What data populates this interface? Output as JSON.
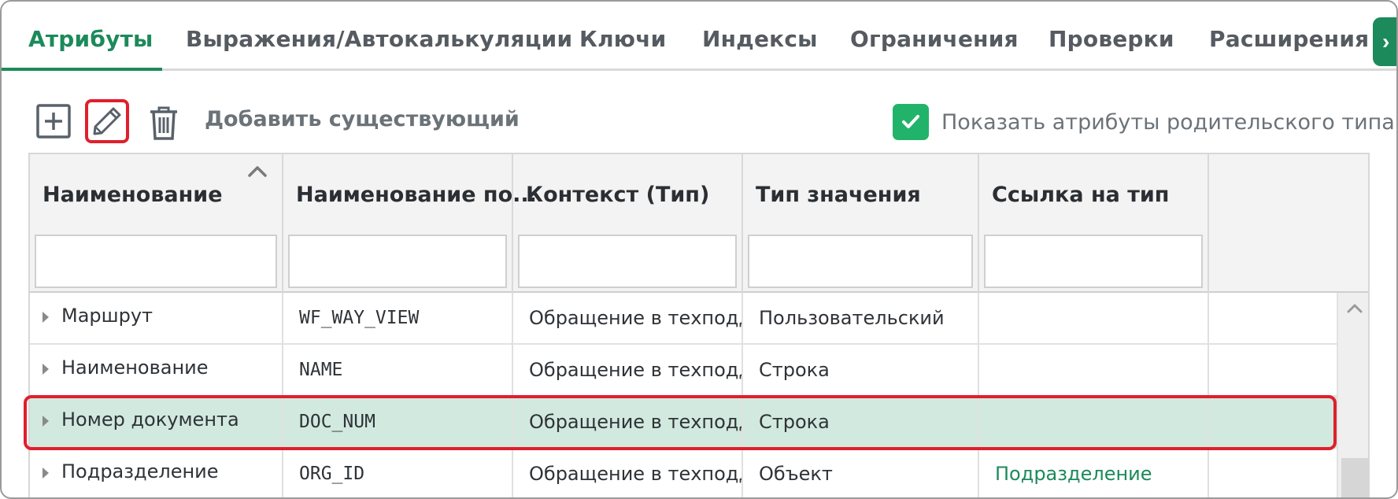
{
  "tabs": [
    {
      "label": "Атрибуты",
      "active": true
    },
    {
      "label": "Выражения/Автокалькуляции"
    },
    {
      "label": "Ключи"
    },
    {
      "label": "Индексы"
    },
    {
      "label": "Ограничения"
    },
    {
      "label": "Проверки"
    },
    {
      "label": "Расширения"
    }
  ],
  "tab_next_glyph": "›",
  "toolbar": {
    "add_icon": "plus-square-icon",
    "edit_icon": "pencil-icon",
    "delete_icon": "trash-icon",
    "add_existing_label": "Добавить существующий"
  },
  "show_parent": {
    "checked": true,
    "label": "Показать атрибуты родительского типа"
  },
  "grid": {
    "columns": [
      {
        "title": "Наименование",
        "sorted": "asc"
      },
      {
        "title": "Наименование по..."
      },
      {
        "title": "Контекст (Тип)"
      },
      {
        "title": "Тип значения"
      },
      {
        "title": "Ссылка на тип"
      }
    ],
    "rows": [
      {
        "name": "Маршрут",
        "code": "WF_WAY_VIEW",
        "context": "Обращение в техподдерж",
        "value_type": "Пользовательский",
        "ref_type": ""
      },
      {
        "name": "Наименование",
        "code": "NAME",
        "context": "Обращение в техподдерж",
        "value_type": "Строка",
        "ref_type": ""
      },
      {
        "name": "Номер документа",
        "code": "DOC_NUM",
        "context": "Обращение в техподдерж",
        "value_type": "Строка",
        "ref_type": "",
        "selected": true
      },
      {
        "name": "Подразделение",
        "code": "ORG_ID",
        "context": "Обращение в техподдерж",
        "value_type": "Объект",
        "ref_type": "Подразделение"
      }
    ]
  },
  "colors": {
    "accent": "#1c8a5a",
    "selection": "#d2e9df",
    "highlight": "#e01f2d",
    "checkbox": "#22b36b"
  }
}
